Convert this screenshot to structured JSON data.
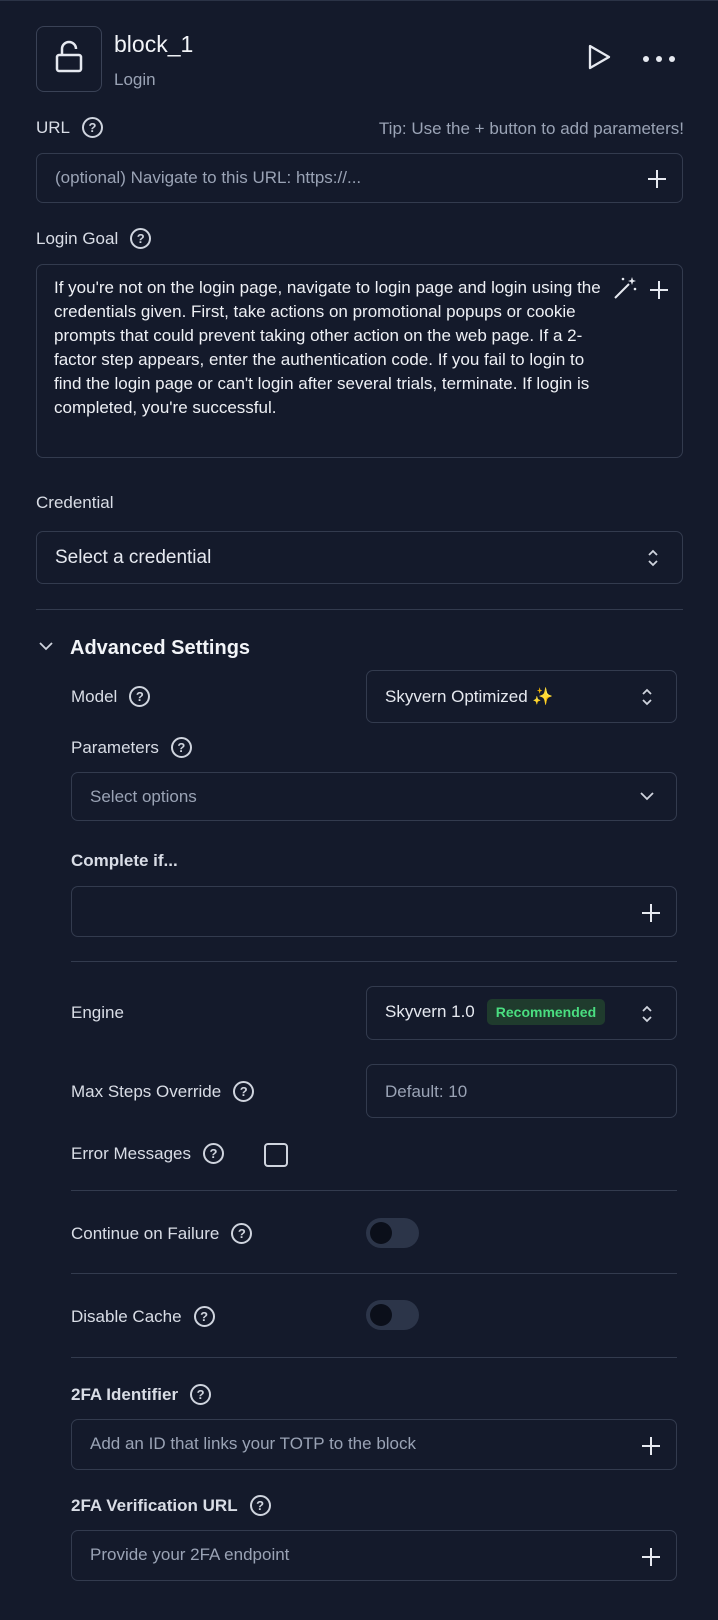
{
  "header": {
    "title": "block_1",
    "subtitle": "Login",
    "block_icon": "lock-icon",
    "run_icon": "play-icon",
    "menu_icon": "more-icon"
  },
  "url": {
    "label": "URL",
    "tip": "Tip: Use the + button to add parameters!",
    "placeholder": "(optional) Navigate to this URL: https://..."
  },
  "login_goal": {
    "label": "Login Goal",
    "text": "If you're not on the login page, navigate to login page and login using the credentials given. First, take actions on promotional popups or cookie prompts that could prevent taking other action on the web page. If a 2-factor step appears, enter the authentication code. If you fail to login to find the login page or can't login after several trials, terminate. If login is completed, you're successful."
  },
  "credential": {
    "label": "Credential",
    "value": "Select a credential"
  },
  "advanced": {
    "title": "Advanced Settings",
    "model_label": "Model",
    "model_value": "Skyvern Optimized ✨",
    "parameters_label": "Parameters",
    "parameters_placeholder": "Select options",
    "complete_if_label": "Complete if...",
    "complete_if_value": "",
    "engine_label": "Engine",
    "engine_value": "Skyvern 1.0",
    "engine_badge": "Recommended",
    "max_steps_label": "Max Steps Override",
    "max_steps_placeholder": "Default: 10",
    "error_messages_label": "Error Messages",
    "error_messages_checked": false,
    "continue_on_failure_label": "Continue on Failure",
    "continue_on_failure_on": false,
    "disable_cache_label": "Disable Cache",
    "disable_cache_on": false,
    "twofa_identifier_label": "2FA Identifier",
    "twofa_identifier_placeholder": "Add an ID that links your TOTP to the block",
    "twofa_url_label": "2FA Verification URL",
    "twofa_url_placeholder": "Provide your 2FA endpoint"
  },
  "colors": {
    "background": "#141a2b",
    "border": "#333b4e",
    "badge_bg": "#1f3b2d",
    "badge_text": "#4ade80"
  }
}
